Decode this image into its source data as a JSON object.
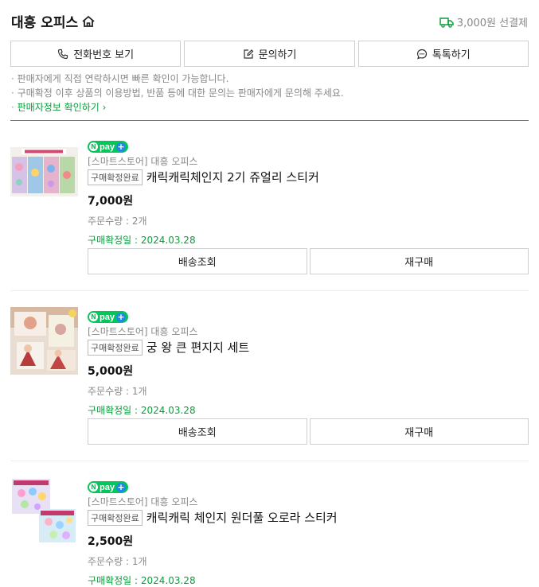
{
  "store": {
    "name": "대흥 오피스",
    "shipping": "3,000원 선결제"
  },
  "actions": {
    "call": "전화번호 보기",
    "inquiry": "문의하기",
    "talk": "톡톡하기"
  },
  "notice": {
    "line1": "판매자에게 직접 연락하시면 빠른 확인이 가능합니다.",
    "line2": "구매확정 이후 상품의 이용방법, 반품 등에 대한 문의는 판매자에게 문의해 주세요.",
    "link": "판매자정보 확인하기"
  },
  "orders": [
    {
      "seller": "[스마트스토어] 대흥 오피스",
      "badge": "구매확정완료",
      "name": "캐릭캐릭체인지 2기 쥬얼리 스티커",
      "price": "7,000원",
      "qty": "주문수량 : 2개",
      "confirm": "구매확정일 : 2024.03.28",
      "btn_track": "배송조회",
      "btn_rebuy": "재구매"
    },
    {
      "seller": "[스마트스토어] 대흥 오피스",
      "badge": "구매확정완료",
      "name": "궁 왕 큰 편지지 세트",
      "price": "5,000원",
      "qty": "주문수량 : 1개",
      "confirm": "구매확정일 : 2024.03.28",
      "btn_track": "배송조회",
      "btn_rebuy": "재구매"
    },
    {
      "seller": "[스마트스토어] 대흥 오피스",
      "badge": "구매확정완료",
      "name": "캐릭캐릭 체인지 원더풀 오로라 스티커",
      "price": "2,500원",
      "qty": "주문수량 : 1개",
      "confirm": "구매확정일 : 2024.03.28"
    }
  ],
  "npay": {
    "n": "N",
    "pay": "pay",
    "plus": "+"
  },
  "colors": {
    "accent_green": "#0a9e3c",
    "npay_green": "#03c75a",
    "npay_blue": "#1e88e5"
  }
}
